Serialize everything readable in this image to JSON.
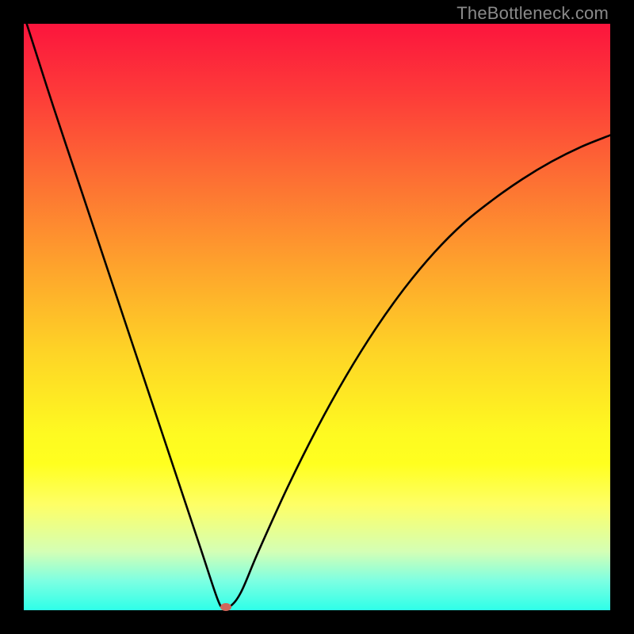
{
  "watermark": "TheBottleneck.com",
  "chart_data": {
    "type": "line",
    "title": "",
    "xlabel": "",
    "ylabel": "",
    "xlim": [
      0,
      100
    ],
    "ylim": [
      0,
      100
    ],
    "series": [
      {
        "name": "curve",
        "x": [
          0.5,
          5,
          10,
          15,
          20,
          25,
          30,
          33,
          34,
          35,
          37,
          40,
          45,
          50,
          55,
          60,
          65,
          70,
          75,
          80,
          85,
          90,
          95,
          100
        ],
        "y": [
          100,
          86,
          71,
          56,
          41,
          26,
          11,
          2,
          0.5,
          0.5,
          3,
          10,
          21,
          31,
          40,
          48,
          55,
          61,
          66,
          70,
          73.5,
          76.5,
          79,
          81
        ]
      }
    ],
    "marker": {
      "x": 34.5,
      "y": 0.5,
      "color": "#d0675a"
    },
    "gradient_stops": [
      {
        "pos": 0,
        "color": "#fc153d"
      },
      {
        "pos": 12,
        "color": "#fd3b39"
      },
      {
        "pos": 27,
        "color": "#fd7133"
      },
      {
        "pos": 42,
        "color": "#fea52c"
      },
      {
        "pos": 56,
        "color": "#fed426"
      },
      {
        "pos": 70,
        "color": "#fefa21"
      },
      {
        "pos": 75,
        "color": "#ffff1f"
      },
      {
        "pos": 82,
        "color": "#feff66"
      },
      {
        "pos": 90,
        "color": "#d4ffb5"
      },
      {
        "pos": 95,
        "color": "#7dffe2"
      },
      {
        "pos": 100,
        "color": "#2effe8"
      }
    ]
  }
}
